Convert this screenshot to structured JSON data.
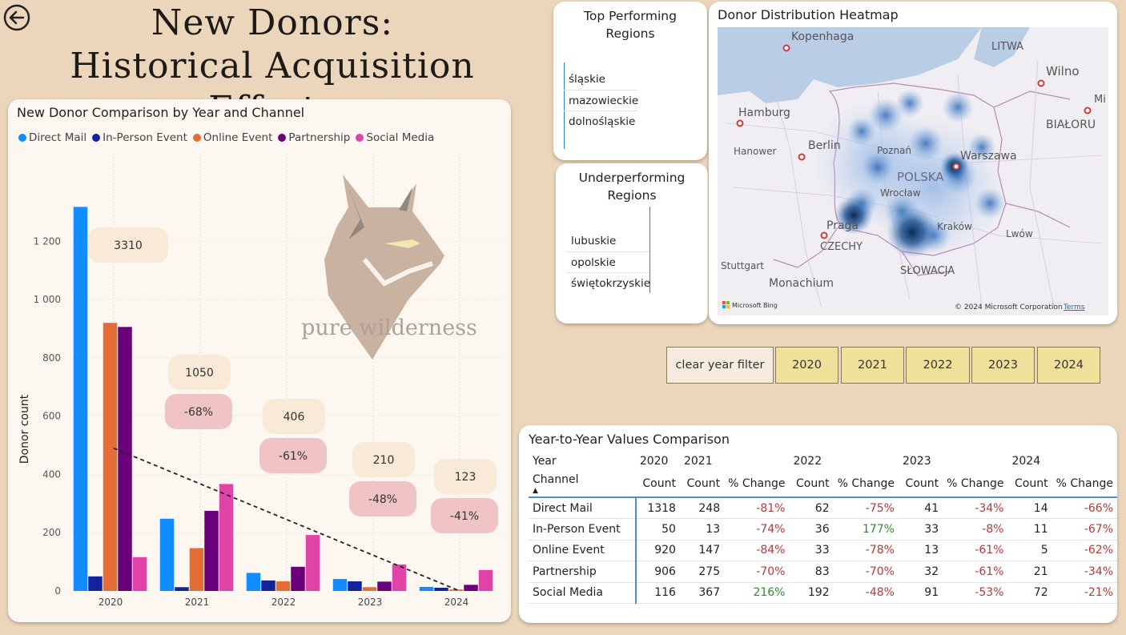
{
  "page": {
    "title_line1": "New Donors:",
    "title_line2": "Historical Acquisition Efforts"
  },
  "colors": {
    "background": "#ecd6bb",
    "direct_mail": "#118dff",
    "in_person": "#12239e",
    "online": "#e66c37",
    "partnership": "#6b007b",
    "social": "#e044a7",
    "total_badge": "#f8ead7",
    "change_badge": "#f0c4c4"
  },
  "icons": {
    "back": "back-arrow-icon",
    "logo": "lynx-logo-icon"
  },
  "logo_text": "pure wilderness",
  "chart_data": {
    "type": "bar",
    "title": "New Donor Comparison by Year and Channel",
    "xlabel": "",
    "ylabel": "Donor count",
    "categories": [
      "2020",
      "2021",
      "2022",
      "2023",
      "2024"
    ],
    "ylim": [
      0,
      1330
    ],
    "yticks": [
      0,
      200,
      400,
      600,
      800,
      1000,
      1200
    ],
    "ytick_labels": [
      "0",
      "200",
      "400",
      "600",
      "800",
      "1 000",
      "1 200"
    ],
    "grid": true,
    "legend_position": "top-left",
    "series": [
      {
        "name": "Direct Mail",
        "color": "#118dff",
        "values": [
          1318,
          248,
          62,
          41,
          14
        ]
      },
      {
        "name": "In-Person Event",
        "color": "#12239e",
        "values": [
          50,
          13,
          36,
          33,
          11
        ]
      },
      {
        "name": "Online Event",
        "color": "#e66c37",
        "values": [
          920,
          147,
          33,
          13,
          5
        ]
      },
      {
        "name": "Partnership",
        "color": "#6b007b",
        "values": [
          906,
          275,
          83,
          32,
          21
        ]
      },
      {
        "name": "Social Media",
        "color": "#e044a7",
        "values": [
          116,
          367,
          192,
          91,
          72
        ]
      }
    ],
    "totals": [
      "3310",
      "1050",
      "406",
      "210",
      "123"
    ],
    "changes": [
      "",
      "-68%",
      "-61%",
      "-48%",
      "-41%"
    ],
    "trendline": {
      "style": "dashed",
      "color": "#222222",
      "start": [
        2020,
        490
      ],
      "end": [
        2024,
        0
      ]
    }
  },
  "top_regions": {
    "title_line1": "Top Performing",
    "title_line2": "Regions",
    "items": [
      "śląskie",
      "mazowieckie",
      "dolnośląskie"
    ]
  },
  "under_regions": {
    "title_line1": "Underperforming",
    "title_line2": "Regions",
    "items": [
      "lubuskie",
      "opolskie",
      "świętokrzyskie"
    ]
  },
  "map": {
    "title": "Donor Distribution Heatmap",
    "country": "POLSKA",
    "cities": [
      "Kopenhaga",
      "Hamburg",
      "Hanower",
      "Berlin",
      "Poznań",
      "Warszawa",
      "Wrocław",
      "Praga",
      "Kraków",
      "Lwów",
      "Wilno",
      "LITWA",
      "BIAŁORU",
      "CZECHY",
      "SŁOWACJA",
      "Stuttgart",
      "Monachium",
      "Mi"
    ],
    "attribution": "Microsoft Bing",
    "copyright": "© 2024 Microsoft Corporation",
    "terms": "Terms"
  },
  "filters": {
    "clear_label": "clear year filter",
    "years": [
      "2020",
      "2021",
      "2022",
      "2023",
      "2024"
    ]
  },
  "table": {
    "title": "Year-to-Year Values Comparison",
    "year_label": "Year",
    "channel_label": "Channel",
    "years": [
      "2020",
      "2021",
      "2022",
      "2023",
      "2024"
    ],
    "count_label": "Count",
    "change_label": "% Change",
    "rows": [
      {
        "channel": "Direct Mail",
        "c2020": "1318",
        "c2021": "248",
        "p2021": "-81%",
        "c2022": "62",
        "p2022": "-75%",
        "c2023": "41",
        "p2023": "-34%",
        "c2024": "14",
        "p2024": "-66%"
      },
      {
        "channel": "In-Person Event",
        "c2020": "50",
        "c2021": "13",
        "p2021": "-74%",
        "c2022": "36",
        "p2022": "177%",
        "c2023": "33",
        "p2023": "-8%",
        "c2024": "11",
        "p2024": "-67%"
      },
      {
        "channel": "Online Event",
        "c2020": "920",
        "c2021": "147",
        "p2021": "-84%",
        "c2022": "33",
        "p2022": "-78%",
        "c2023": "13",
        "p2023": "-61%",
        "c2024": "5",
        "p2024": "-62%"
      },
      {
        "channel": "Partnership",
        "c2020": "906",
        "c2021": "275",
        "p2021": "-70%",
        "c2022": "83",
        "p2022": "-70%",
        "c2023": "32",
        "p2023": "-61%",
        "c2024": "21",
        "p2024": "-34%"
      },
      {
        "channel": "Social Media",
        "c2020": "116",
        "c2021": "367",
        "p2021": "216%",
        "c2022": "192",
        "p2022": "-48%",
        "c2023": "91",
        "p2023": "-53%",
        "c2024": "72",
        "p2024": "-21%"
      }
    ]
  }
}
